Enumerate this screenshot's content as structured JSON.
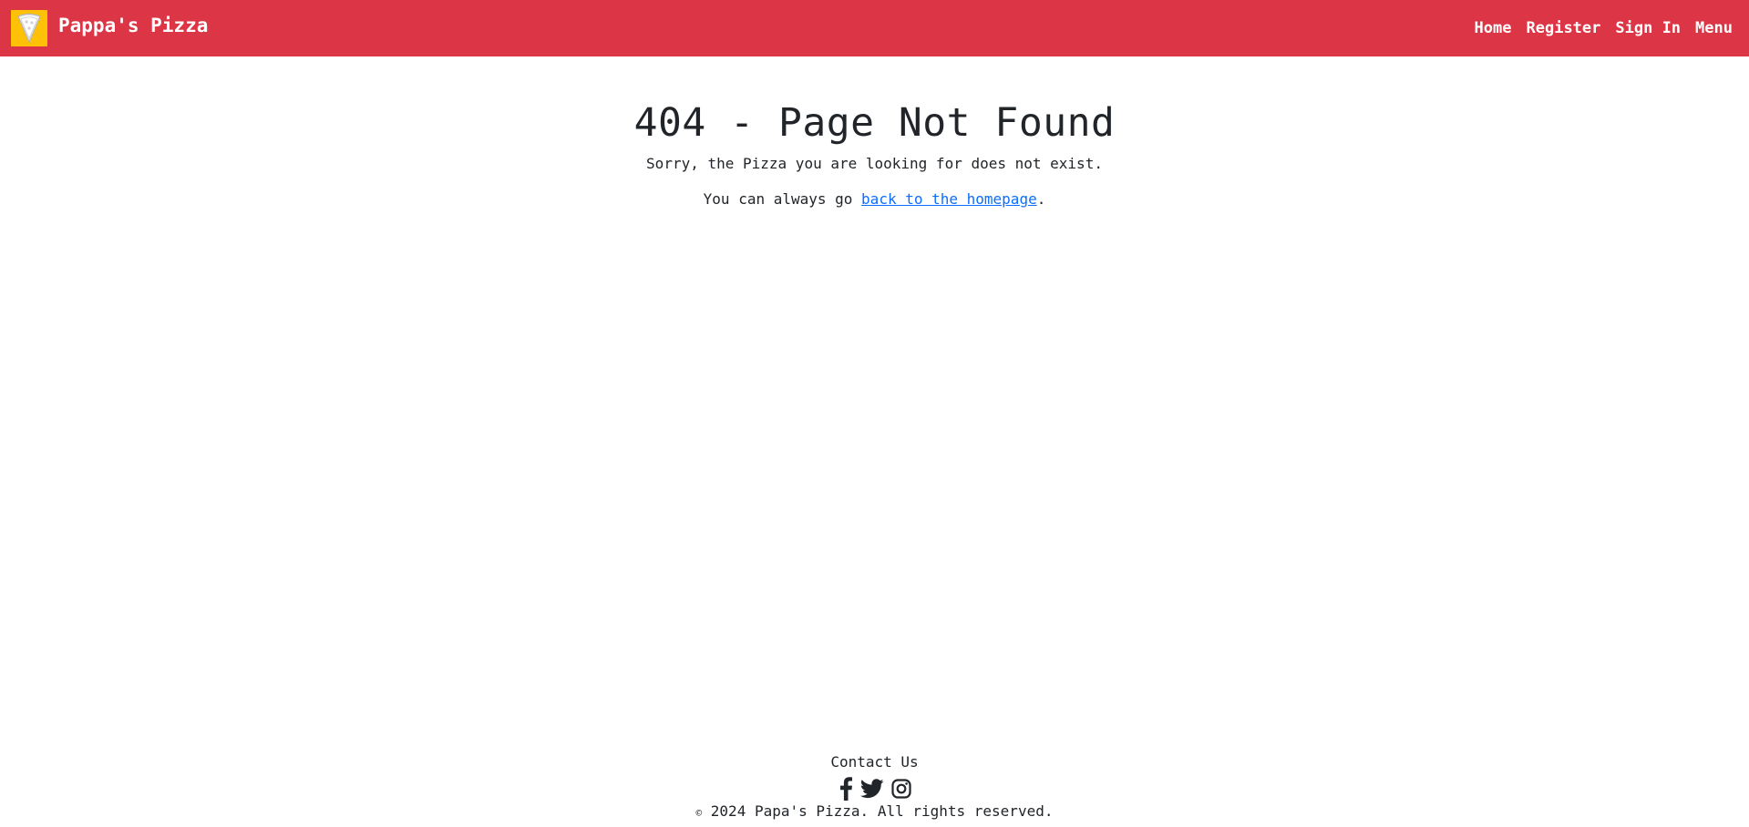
{
  "brand": {
    "name": "Pappa's Pizza",
    "logo_icon": "pizza-slice-icon",
    "logo_bg": "#ffc107"
  },
  "nav": {
    "items": [
      {
        "label": "Home"
      },
      {
        "label": "Register"
      },
      {
        "label": "Sign In"
      },
      {
        "label": "Menu"
      }
    ]
  },
  "main": {
    "title": "404 - Page Not Found",
    "message": "Sorry, the Pizza you are looking for does not exist.",
    "homepage_prefix": "You can always go ",
    "homepage_link": "back to the homepage",
    "homepage_suffix": "."
  },
  "footer": {
    "contact_title": "Contact Us",
    "social_icons": [
      "facebook-icon",
      "twitter-icon",
      "instagram-icon"
    ],
    "copyright_symbol": "©",
    "copyright_text": " 2024 Papa's Pizza. All rights reserved."
  },
  "colors": {
    "navbar": "#dc3545",
    "link": "#0d6efd",
    "text": "#212529"
  }
}
